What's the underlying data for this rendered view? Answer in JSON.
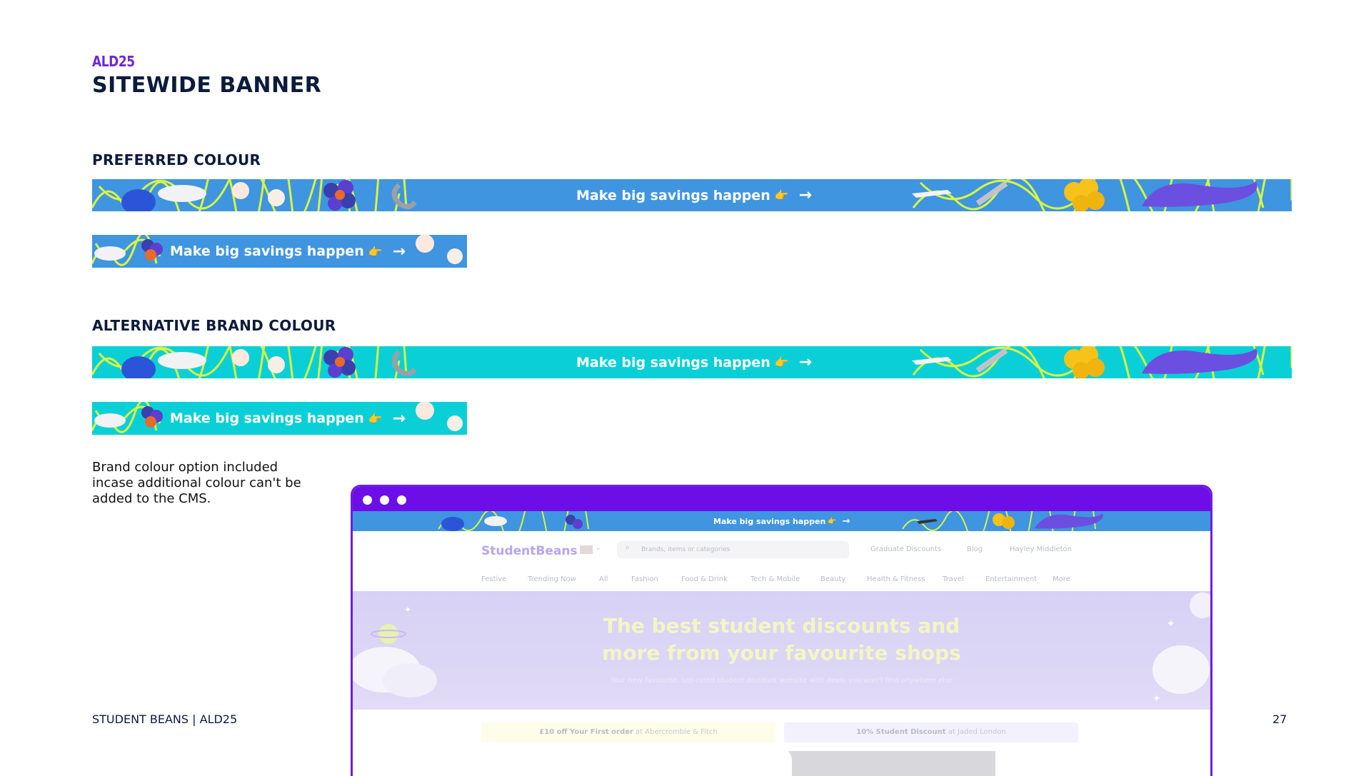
{
  "eyebrow": "ALD25",
  "title": "SITEWIDE BANNER",
  "preferred_label": "PREFERRED COLOUR",
  "alternative_label": "ALTERNATIVE BRAND COLOUR",
  "banner_text": "Make big savings happen",
  "banner_emoji": "👉",
  "banner_arrow": "→",
  "colors": {
    "preferred": "#3f95e0",
    "alternative": "#0bcfd6",
    "accent_purple": "#6d0ee8",
    "squiggle": "#d6f542"
  },
  "note": "Brand colour option included incase additional colour can't be added to the CMS.",
  "footer_left": "STUDENT BEANS | ALD25",
  "page_number": "27",
  "mockup": {
    "logo": "StudentBeans",
    "search_placeholder": "Brands, items or categories",
    "links": [
      "Graduate Discounts",
      "Blog",
      "Hayley Middleton"
    ],
    "categories": [
      "Festive",
      "Trending Now",
      "All",
      "Fashion",
      "Food & Drink",
      "Tech & Mobile",
      "Beauty",
      "Health & Fitness",
      "Travel",
      "Entertainment",
      "More"
    ],
    "hero_title_line1": "The best student discounts and",
    "hero_title_line2": "more from your favourite shops",
    "hero_subtitle": "Your new favourite, top-rated student discount website with deals you won't find anywhere else",
    "deal1_bold": "£10 off Your First order",
    "deal1_rest": " at Abercrombie & Fitch",
    "deal2_bold": "10% Student Discount",
    "deal2_rest": " at Jaded London"
  }
}
